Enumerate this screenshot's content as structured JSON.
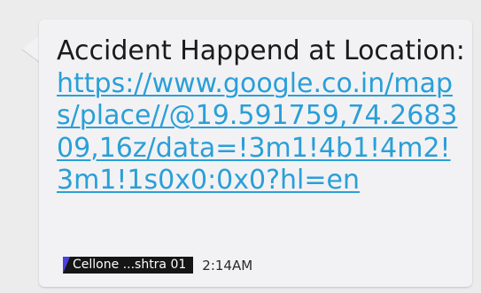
{
  "message": {
    "prefix": "Accident Happend at Location: ",
    "link": "https://www.google.co.in/maps/place//@19.591759,74.268309,16z/data=!3m1!4b1!4m2!3m1!1s0x0:0x0?hl=en"
  },
  "meta": {
    "sim_label": "Cellone ...shtra 01",
    "time": "2:14AM"
  },
  "colors": {
    "bubble": "#f2f2f4",
    "link": "#2a9fd8",
    "badge": "#151515",
    "badge_corner": "#4b3fe0"
  }
}
